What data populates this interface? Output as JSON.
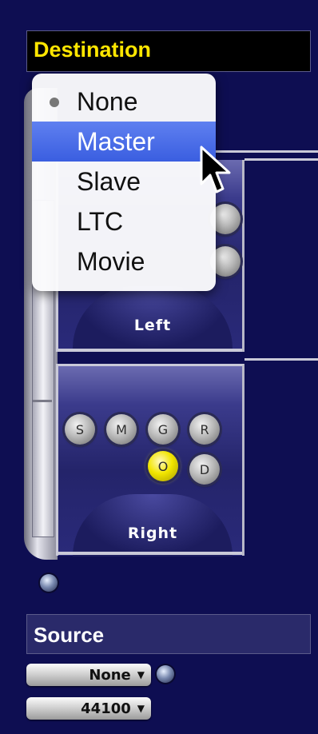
{
  "destination": {
    "title": "Destination",
    "menu": {
      "items": [
        "None",
        "Master",
        "Slave",
        "LTC",
        "Movie"
      ],
      "checked": "None",
      "highlighted": "Master"
    }
  },
  "channels": {
    "left": {
      "label": "Left"
    },
    "right": {
      "label": "Right",
      "buttons": [
        "S",
        "M",
        "G",
        "R",
        "O",
        "D"
      ],
      "active": "O"
    }
  },
  "source": {
    "title": "Source",
    "mode_select": "None",
    "rate_select": "44100"
  },
  "colors": {
    "background": "#0e0e52",
    "destination_title": "#ffe600",
    "menu_highlight": "#3a5ee0",
    "active_button": "#f2e600"
  },
  "icons": [
    "arrow-cursor-icon",
    "knob-icon",
    "popup-arrow-icon"
  ]
}
